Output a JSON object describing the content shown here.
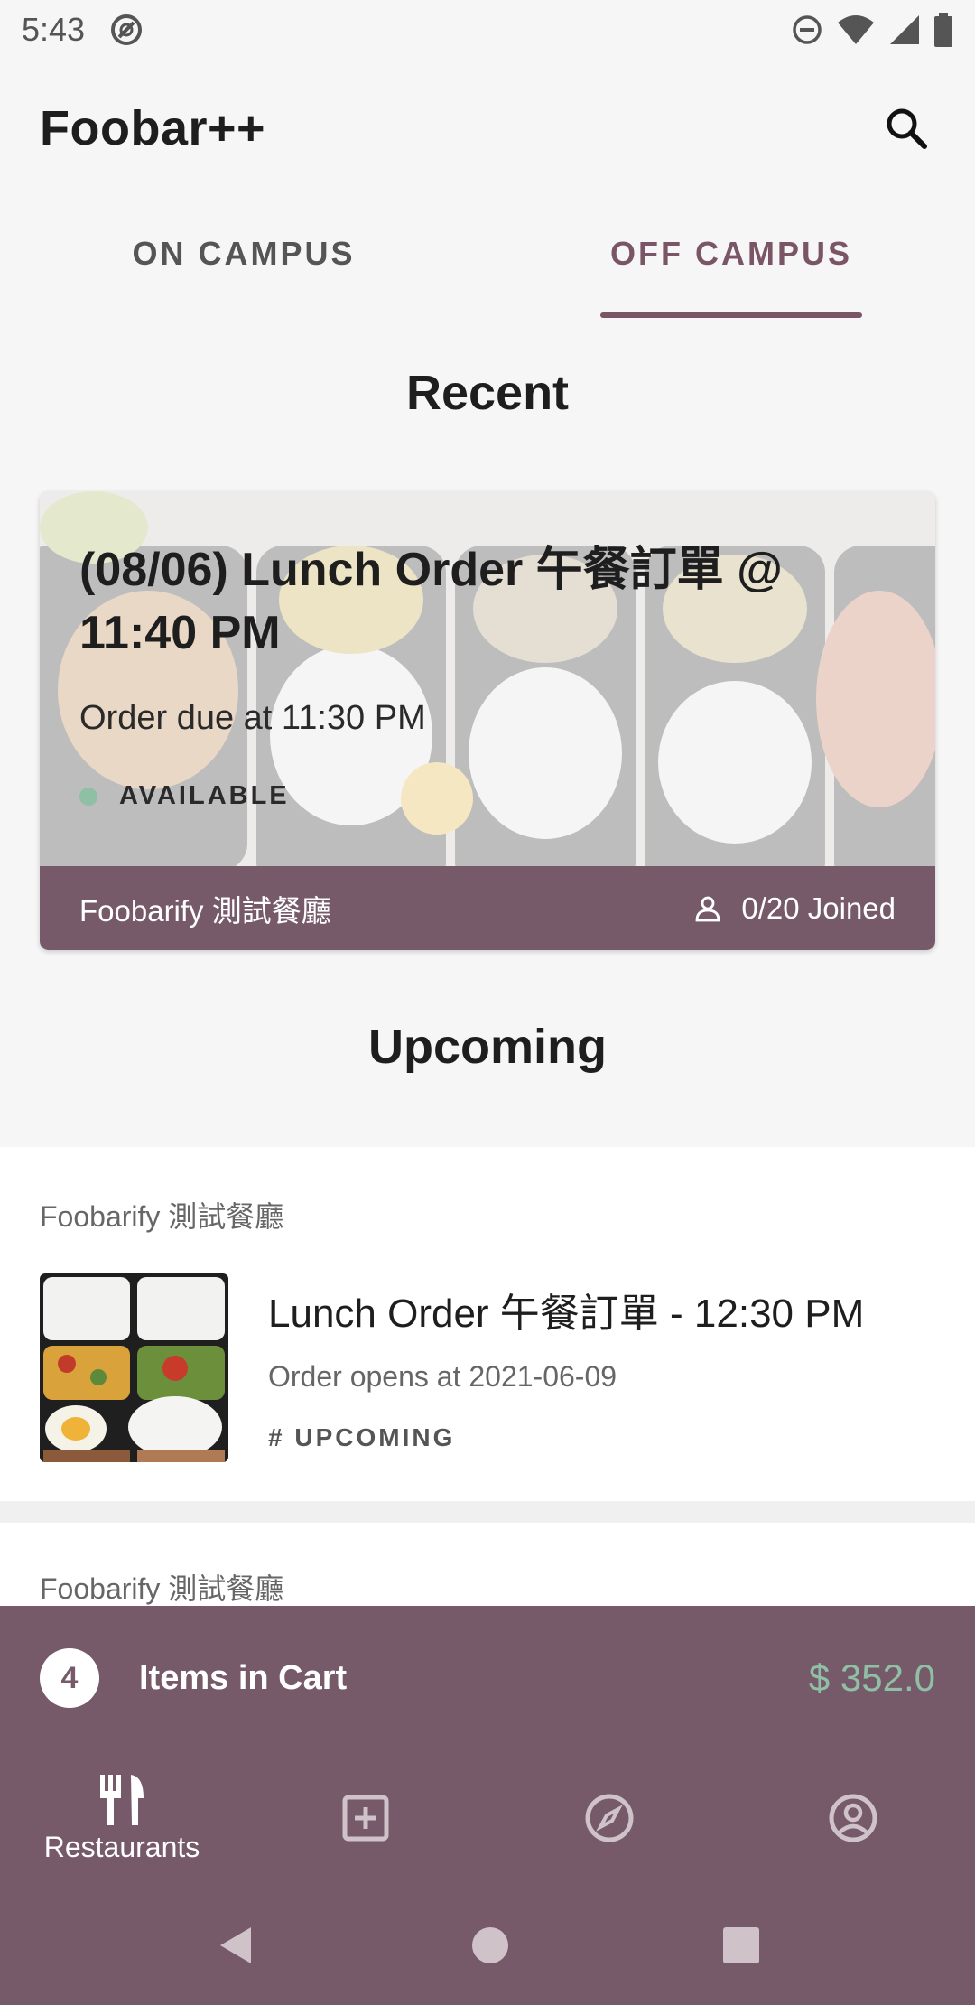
{
  "status_bar": {
    "time": "5:43"
  },
  "app_bar": {
    "title": "Foobar++"
  },
  "tabs": [
    {
      "label": "ON CAMPUS",
      "active": false
    },
    {
      "label": "OFF CAMPUS",
      "active": true
    }
  ],
  "recent": {
    "heading": "Recent",
    "card": {
      "title": "(08/06) Lunch Order 午餐訂單 @ 11:40 PM",
      "due": "Order due at 11:30 PM",
      "status": "AVAILABLE",
      "restaurant": "Foobarify 測試餐廳",
      "joined": "0/20 Joined"
    }
  },
  "upcoming": {
    "heading": "Upcoming",
    "items": [
      {
        "restaurant": "Foobarify 測試餐廳",
        "title": "Lunch Order 午餐訂單 - 12:30 PM",
        "subtitle": "Order opens at 2021-06-09",
        "tag": "# UPCOMING"
      },
      {
        "restaurant": "Foobarify 測試餐廳"
      }
    ]
  },
  "cart": {
    "count": "4",
    "label": "Items in Cart",
    "total": "$ 352.0"
  },
  "bottom_nav": {
    "restaurants_label": "Restaurants"
  },
  "colors": {
    "primary": "#765a6a",
    "accent": "#8fbfa5",
    "background": "#f6f6f6"
  }
}
